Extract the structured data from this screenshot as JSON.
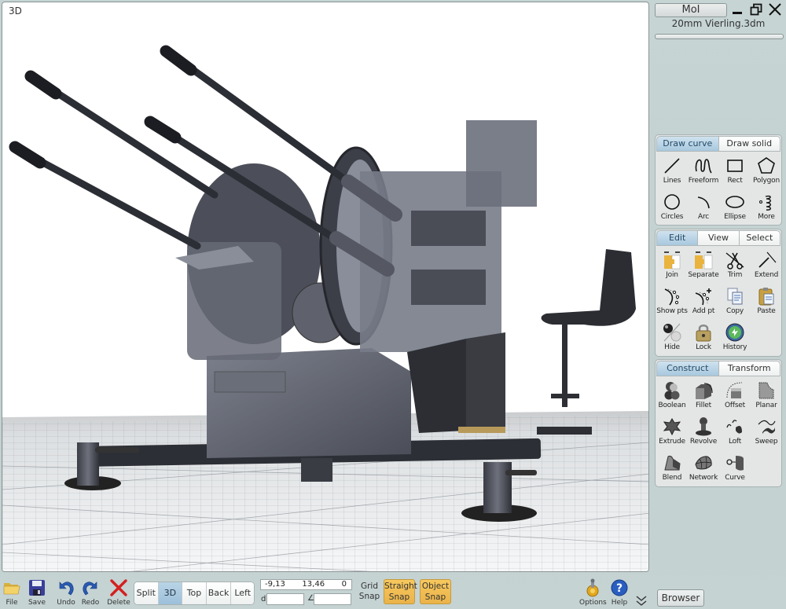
{
  "window": {
    "user_button": "MoI",
    "document_name": "20mm Vierling.3dm",
    "controls": {
      "minimize": "_",
      "restore": "restore-icon",
      "close": "✕"
    }
  },
  "viewport": {
    "label": "3D",
    "scene_description": "Shaded 3D model of a quad 20mm anti-aircraft gun (Flakvierling) on a grid ground plane"
  },
  "draw_panel": {
    "tabs": [
      {
        "label": "Draw curve",
        "active": true
      },
      {
        "label": "Draw solid",
        "active": false
      }
    ],
    "tools": [
      {
        "label": "Lines",
        "icon": "line-icon"
      },
      {
        "label": "Freeform",
        "icon": "freeform-icon"
      },
      {
        "label": "Rect",
        "icon": "rectangle-icon"
      },
      {
        "label": "Polygon",
        "icon": "polygon-icon"
      },
      {
        "label": "Circles",
        "icon": "circle-icon"
      },
      {
        "label": "Arc",
        "icon": "arc-icon"
      },
      {
        "label": "Ellipse",
        "icon": "ellipse-icon"
      },
      {
        "label": "More",
        "icon": "helix-icon"
      }
    ]
  },
  "edit_panel": {
    "tabs": [
      {
        "label": "Edit",
        "active": true
      },
      {
        "label": "View",
        "active": false
      },
      {
        "label": "Select",
        "active": false
      }
    ],
    "tools": [
      {
        "label": "Join",
        "icon": "join-icon"
      },
      {
        "label": "Separate",
        "icon": "separate-icon"
      },
      {
        "label": "Trim",
        "icon": "scissors-icon"
      },
      {
        "label": "Extend",
        "icon": "extend-icon"
      },
      {
        "label": "Show pts",
        "icon": "show-points-icon"
      },
      {
        "label": "Add pt",
        "icon": "add-point-icon"
      },
      {
        "label": "Copy",
        "icon": "copy-icon"
      },
      {
        "label": "Paste",
        "icon": "paste-icon"
      },
      {
        "label": "Hide",
        "icon": "hide-icon"
      },
      {
        "label": "Lock",
        "icon": "lock-icon"
      },
      {
        "label": "History",
        "icon": "history-icon"
      }
    ]
  },
  "construct_panel": {
    "tabs": [
      {
        "label": "Construct",
        "active": true
      },
      {
        "label": "Transform",
        "active": false
      }
    ],
    "tools": [
      {
        "label": "Boolean",
        "icon": "boolean-icon"
      },
      {
        "label": "Fillet",
        "icon": "fillet-icon"
      },
      {
        "label": "Offset",
        "icon": "offset-icon"
      },
      {
        "label": "Planar",
        "icon": "planar-icon"
      },
      {
        "label": "Extrude",
        "icon": "extrude-icon"
      },
      {
        "label": "Revolve",
        "icon": "revolve-icon"
      },
      {
        "label": "Loft",
        "icon": "loft-icon"
      },
      {
        "label": "Sweep",
        "icon": "sweep-icon"
      },
      {
        "label": "Blend",
        "icon": "blend-icon"
      },
      {
        "label": "Network",
        "icon": "network-icon"
      },
      {
        "label": "Curve",
        "icon": "curve-icon"
      }
    ]
  },
  "bottom_toolbar": {
    "file": "File",
    "save": "Save",
    "undo": "Undo",
    "redo": "Redo",
    "delete": "Delete",
    "views": [
      {
        "label": "Split",
        "active": false
      },
      {
        "label": "3D",
        "active": true
      },
      {
        "label": "Top",
        "active": false
      },
      {
        "label": "Back",
        "active": false
      },
      {
        "label": "Left",
        "active": false
      }
    ],
    "coordinates": {
      "x": "-9,13",
      "y": "13,46",
      "z": "0"
    },
    "distance_label": "d",
    "distance_value": "",
    "angle_label": "∠",
    "angle_value": "",
    "grid_snap": {
      "line1": "Grid",
      "line2": "Snap",
      "active": false
    },
    "straight_snap": {
      "line1": "Straight",
      "line2": "Snap",
      "active": true
    },
    "object_snap": {
      "line1": "Object",
      "line2": "Snap",
      "active": true
    },
    "options": "Options",
    "help": "Help",
    "expand": "expand-icon",
    "browser": "Browser"
  },
  "colors": {
    "panel_bg": "#c4d2d2",
    "active_tab": "#a8c8de",
    "snap_active": "#f0bb52"
  }
}
